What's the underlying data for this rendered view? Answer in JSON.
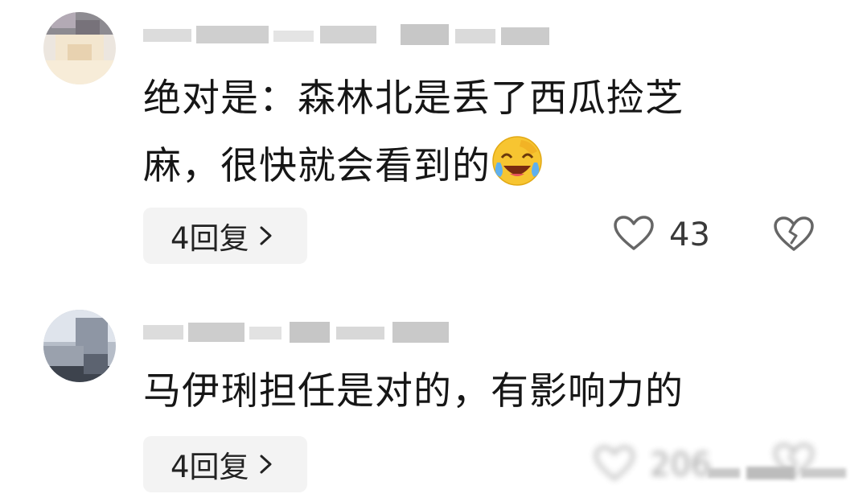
{
  "comments": [
    {
      "text_line1": "绝对是：森林北是丢了西瓜捡芝",
      "text_line2": "麻，很快就会看到的",
      "emoji": "laughing-crying-emoji",
      "reply_label": "4回复",
      "like_count": "43"
    },
    {
      "text_line1": "马伊琍担任是对的，有影响力的",
      "reply_label": "4回复",
      "like_count": "206"
    }
  ],
  "icons": {
    "like": "heart-outline-icon",
    "dislike": "broken-heart-icon",
    "reply_chevron": "chevron-right-icon"
  },
  "colors": {
    "reply_bg": "#f3f3f3",
    "text": "#161616",
    "icon": "#666666"
  }
}
